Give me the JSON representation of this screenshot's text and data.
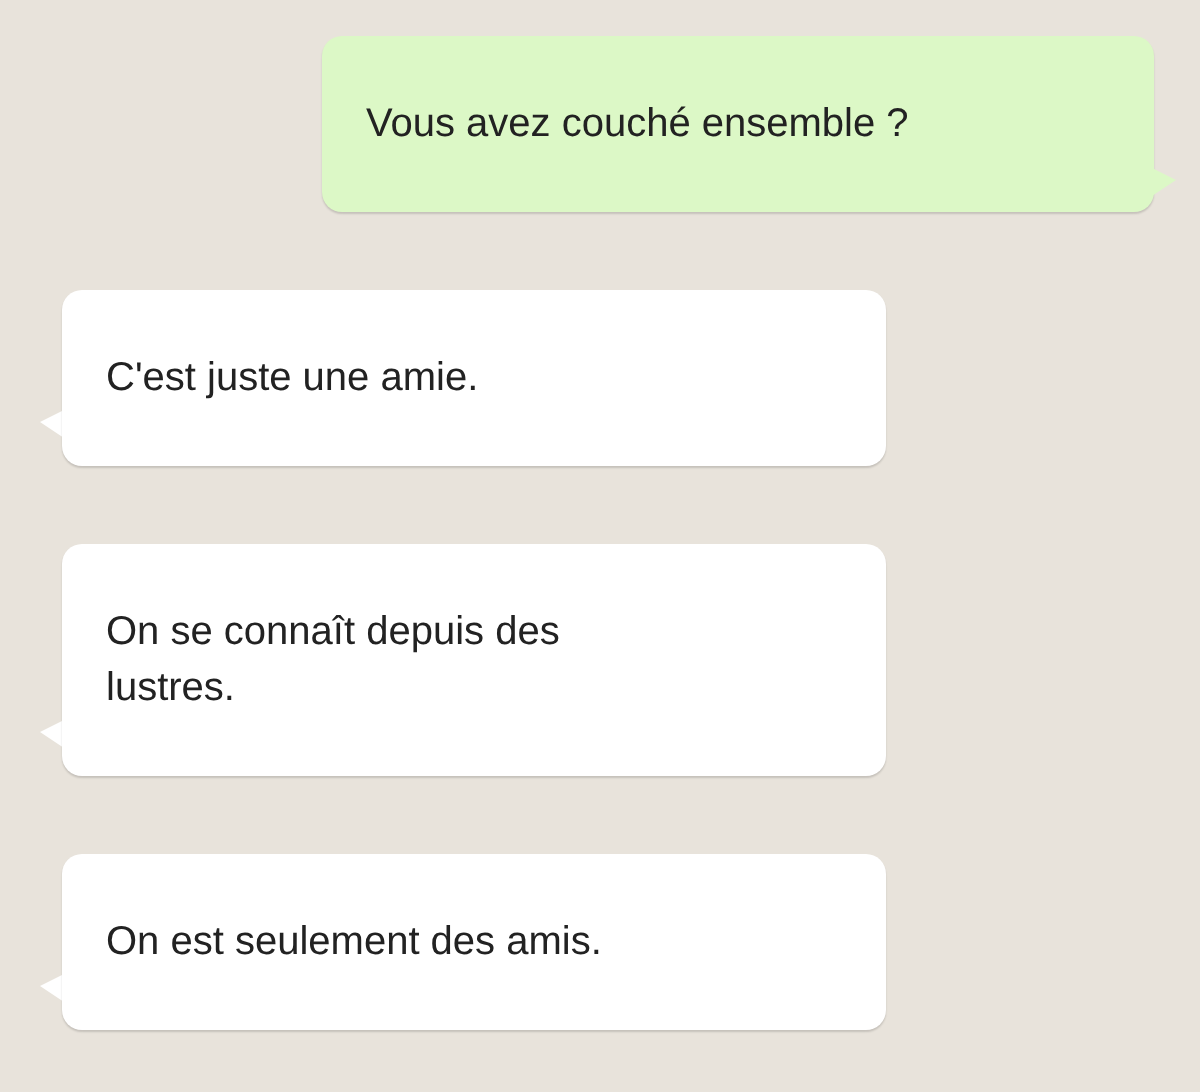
{
  "messages": [
    {
      "kind": "sent",
      "text": "Vous avez couché ensemble ?"
    },
    {
      "kind": "received",
      "text": "C'est juste une amie."
    },
    {
      "kind": "received",
      "text": "On se connaît depuis des lustres."
    },
    {
      "kind": "received",
      "text": "On est seulement des amis."
    }
  ]
}
